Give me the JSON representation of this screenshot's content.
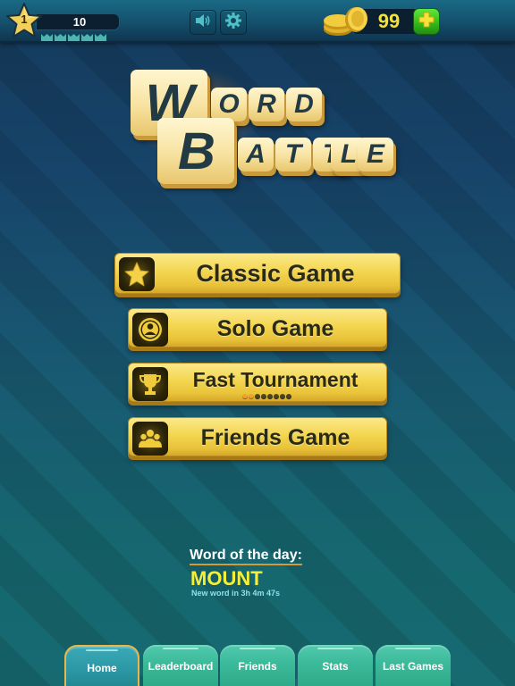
{
  "header": {
    "level": "1",
    "xp": "10",
    "crowns_count": 5,
    "coins": "99",
    "sound_icon": "speaker-icon",
    "settings_icon": "gear-icon",
    "add_coins_icon": "plus-icon"
  },
  "logo": {
    "line1": [
      "W",
      "O",
      "R",
      "D"
    ],
    "line2": [
      "B",
      "A",
      "T",
      "T",
      "L",
      "E"
    ]
  },
  "menu": {
    "buttons": [
      {
        "label": "Classic Game",
        "icon": "star-icon"
      },
      {
        "label": "Solo Game",
        "icon": "user-icon"
      },
      {
        "label": "Fast Tournament",
        "icon": "trophy-icon",
        "progress_filled": 2,
        "progress_total": 8
      },
      {
        "label": "Friends Game",
        "icon": "group-icon"
      }
    ]
  },
  "word_of_day": {
    "title": "Word of the day:",
    "word": "MOUNT",
    "timer": "New word in 3h 4m 47s"
  },
  "tabs": [
    {
      "label": "Home",
      "active": true
    },
    {
      "label": "Leaderboard",
      "active": false
    },
    {
      "label": "Friends",
      "active": false
    },
    {
      "label": "Stats",
      "active": false
    },
    {
      "label": "Last Games",
      "active": false
    }
  ],
  "colors": {
    "button_gold": "#f4d650",
    "coin_text": "#f2e23a",
    "word_yellow": "#f5ef3a",
    "tab_green": "#3cbb9b",
    "tab_active": "#2b96a4",
    "plus_green": "#2fb81a"
  }
}
